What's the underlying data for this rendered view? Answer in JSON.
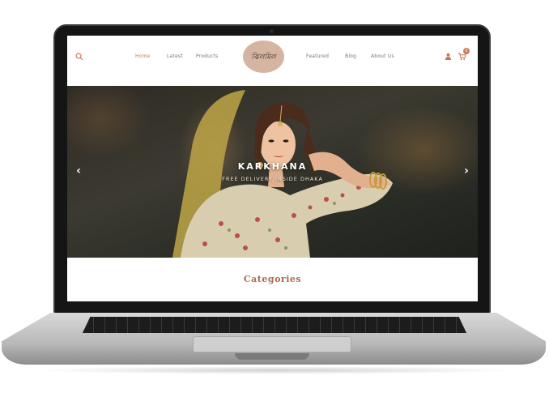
{
  "header": {
    "logo_text": "ঝিলমিল",
    "nav": [
      {
        "label": "Home",
        "active": true
      },
      {
        "label": "Latest",
        "active": false
      },
      {
        "label": "Products",
        "active": false
      },
      {
        "label": "Featured",
        "active": false
      },
      {
        "label": "Blog",
        "active": false
      },
      {
        "label": "About Us",
        "active": false
      }
    ],
    "cart_count": "0",
    "icons": [
      "search-icon",
      "user-icon",
      "cart-icon"
    ]
  },
  "hero": {
    "title": "KARKHANA",
    "subtitle": "FREE DELIVERY INSIDE DHAKA",
    "prev_icon": "chevron-left-icon",
    "next_icon": "chevron-right-icon"
  },
  "sections": {
    "categories_title": "Categories"
  },
  "colors": {
    "accent": "#c9795a",
    "logo_bg": "#d6b4a2",
    "heading": "#b06a4c"
  }
}
